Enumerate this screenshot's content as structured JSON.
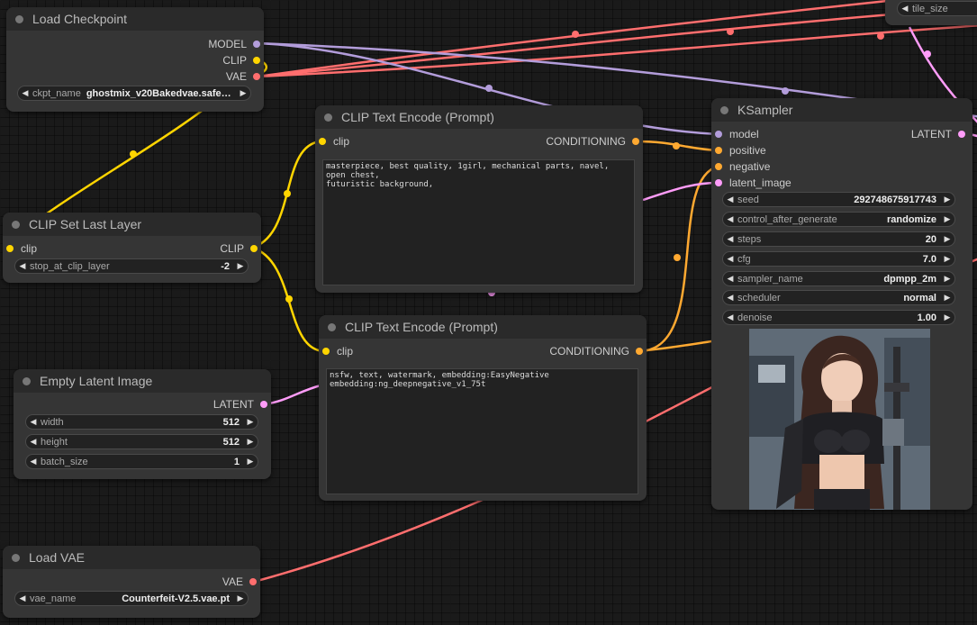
{
  "colors": {
    "model": "#b39ddb",
    "clip": "#ffd500",
    "vae": "#ff6e6e",
    "conditioning": "#ffa931",
    "latent": "#ff9cf9"
  },
  "nodes": {
    "load_checkpoint": {
      "title": "Load Checkpoint",
      "outputs": {
        "model": "MODEL",
        "clip": "CLIP",
        "vae": "VAE"
      },
      "widgets": {
        "ckpt_name": {
          "label": "ckpt_name",
          "value": "ghostmix_v20Bakedvae.safe…"
        }
      }
    },
    "clip_set_last_layer": {
      "title": "CLIP Set Last Layer",
      "inputs": {
        "clip": "clip"
      },
      "outputs": {
        "clip": "CLIP"
      },
      "widgets": {
        "stop_at_clip_layer": {
          "label": "stop_at_clip_layer",
          "value": "-2"
        }
      }
    },
    "clip_text_positive": {
      "title": "CLIP Text Encode (Prompt)",
      "inputs": {
        "clip": "clip"
      },
      "outputs": {
        "conditioning": "CONDITIONING"
      },
      "text": "masterpiece, best quality, 1girl, mechanical parts, navel, open chest,\nfuturistic background,"
    },
    "clip_text_negative": {
      "title": "CLIP Text Encode (Prompt)",
      "inputs": {
        "clip": "clip"
      },
      "outputs": {
        "conditioning": "CONDITIONING"
      },
      "text": "nsfw, text, watermark, embedding:EasyNegative\nembedding:ng_deepnegative_v1_75t"
    },
    "empty_latent": {
      "title": "Empty Latent Image",
      "outputs": {
        "latent": "LATENT"
      },
      "widgets": {
        "width": {
          "label": "width",
          "value": "512"
        },
        "height": {
          "label": "height",
          "value": "512"
        },
        "batch_size": {
          "label": "batch_size",
          "value": "1"
        }
      }
    },
    "load_vae": {
      "title": "Load VAE",
      "outputs": {
        "vae": "VAE"
      },
      "widgets": {
        "vae_name": {
          "label": "vae_name",
          "value": "Counterfeit-V2.5.vae.pt"
        }
      }
    },
    "ksampler": {
      "title": "KSampler",
      "inputs": {
        "model": "model",
        "positive": "positive",
        "negative": "negative",
        "latent_image": "latent_image"
      },
      "outputs": {
        "latent": "LATENT"
      },
      "widgets": {
        "seed": {
          "label": "seed",
          "value": "292748675917743"
        },
        "control_after_generate": {
          "label": "control_after_generate",
          "value": "randomize"
        },
        "steps": {
          "label": "steps",
          "value": "20"
        },
        "cfg": {
          "label": "cfg",
          "value": "7.0"
        },
        "sampler_name": {
          "label": "sampler_name",
          "value": "dpmpp_2m"
        },
        "scheduler": {
          "label": "scheduler",
          "value": "normal"
        },
        "denoise": {
          "label": "denoise",
          "value": "1.00"
        }
      }
    },
    "offscreen_node": {
      "widgets": {
        "tile_size": {
          "label": "tile_size"
        }
      }
    }
  },
  "icons": {
    "left_arrow": "◀",
    "right_arrow": "▶"
  }
}
